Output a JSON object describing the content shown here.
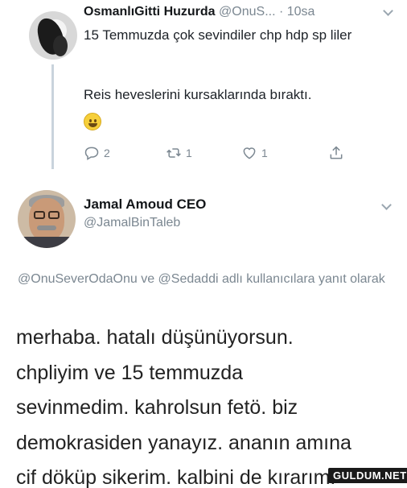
{
  "tweet_1": {
    "author_name": "OsmanlıGitti Huzurda",
    "meta": "@OnuS... · 10sa",
    "text_line_1": "15 Temmuzda çok sevindiler chp hdp sp liler",
    "text_line_2": "Reis heveslerini kursaklarında bıraktı.",
    "emoji": "grinning-face",
    "actions": {
      "reply_count": "2",
      "retweet_count": "1",
      "like_count": "1"
    }
  },
  "tweet_2": {
    "author_name": "Jamal Amoud CEO",
    "handle": "@JamalBinTaleb",
    "reply_to": "@OnuSeverOdaOnu ve @Sedaddi adlı kullanıcılara yanıt olarak",
    "text_lines": [
      "merhaba. hatalı düşünüyorsun.",
      "chpliyim ve 15 temmuzda",
      "sevinmedim. kahrolsun fetö. biz",
      "demokrasiden yanayız. ananın amına",
      "cif döküp sikerim. kalbini de kırarım."
    ]
  },
  "watermark": "GULDUM.NET",
  "colors": {
    "muted_text": "#7b8791",
    "thread_line": "#c9d3dc"
  }
}
